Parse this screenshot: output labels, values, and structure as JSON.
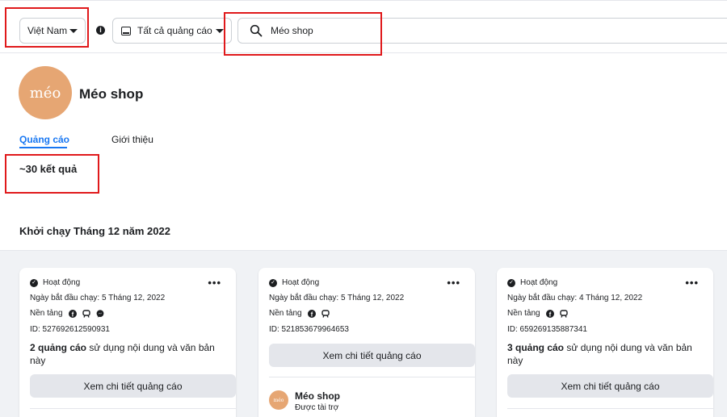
{
  "filters": {
    "country": "Việt Nam",
    "ad_type": "Tất cả quảng cáo",
    "search_value": "Méo shop"
  },
  "page": {
    "avatar_text": "méo",
    "name": "Méo shop"
  },
  "tabs": [
    {
      "label": "Quảng cáo",
      "active": true
    },
    {
      "label": "Giới thiệu",
      "active": false
    }
  ],
  "results_count": "~30 kết quả",
  "launch_heading": "Khởi chạy Tháng 12 năm 2022",
  "cards": [
    {
      "status": "Hoạt động",
      "start_date": "Ngày bắt đầu chạy: 5 Tháng 12, 2022",
      "platform_label": "Nền tảng",
      "ad_id": "ID: 527692612590931",
      "multi_bold": "2 quảng cáo",
      "multi_text": " sử dụng nội dung và văn bản này",
      "button": "Xem chi tiết quảng cáo"
    },
    {
      "status": "Hoạt động",
      "start_date": "Ngày bắt đầu chạy: 5 Tháng 12, 2022",
      "platform_label": "Nền tảng",
      "ad_id": "ID: 521853679964653",
      "button": "Xem chi tiết quảng cáo",
      "advertiser_name": "Méo shop",
      "advertiser_sub": "Được tài trợ"
    },
    {
      "status": "Hoạt động",
      "start_date": "Ngày bắt đầu chạy: 4 Tháng 12, 2022",
      "platform_label": "Nền tảng",
      "ad_id": "ID: 659269135887341",
      "multi_bold": "3 quảng cáo",
      "multi_text": " sử dụng nội dung và văn bản này",
      "button": "Xem chi tiết quảng cáo"
    }
  ],
  "colors": {
    "accent": "#1877f2",
    "highlight_box": "#e0191b",
    "avatar_bg": "#e6a673"
  }
}
